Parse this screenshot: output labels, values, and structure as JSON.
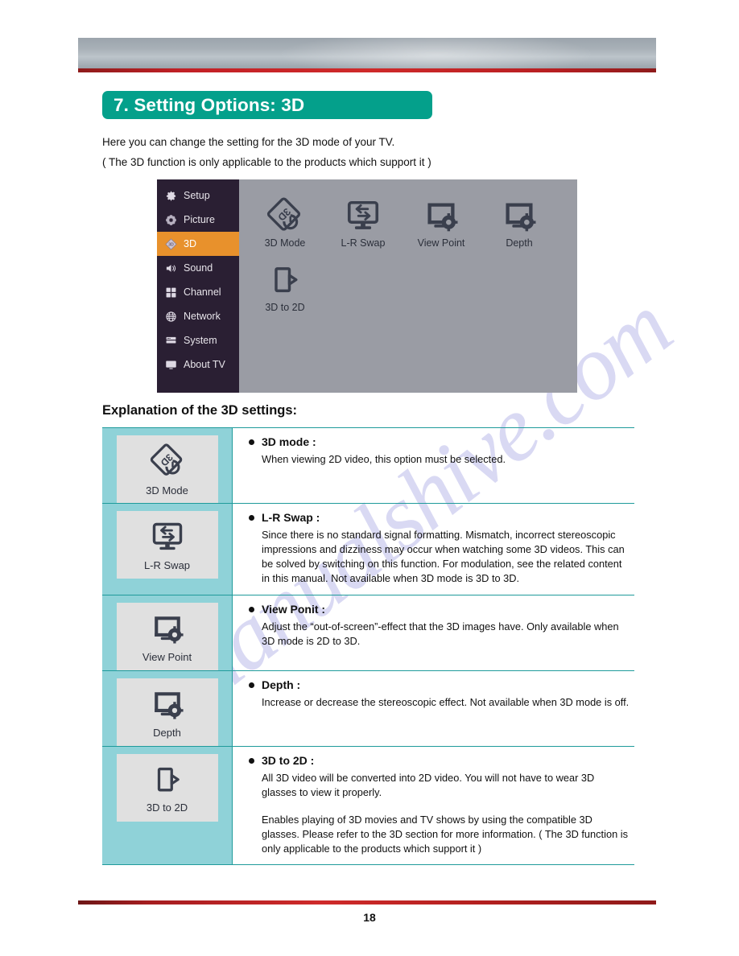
{
  "document": {
    "page_number": "18",
    "watermark": "manualshive.com"
  },
  "section": {
    "title": "7. Setting Options: 3D",
    "accent_color": "#04a08b"
  },
  "intro": {
    "line1": "Here you can change the setting for the 3D mode of your TV.",
    "line2": "( The 3D function is only applicable to the products which support it )"
  },
  "osd": {
    "highlight_color": "#e8912c",
    "sidebar": [
      {
        "label": "Setup",
        "icon": "gear-icon",
        "active": false
      },
      {
        "label": "Picture",
        "icon": "flower-icon",
        "active": false
      },
      {
        "label": "3D",
        "icon": "diamond-3d-icon",
        "active": true
      },
      {
        "label": "Sound",
        "icon": "speaker-icon",
        "active": false
      },
      {
        "label": "Channel",
        "icon": "grid-icon",
        "active": false
      },
      {
        "label": "Network",
        "icon": "globe-icon",
        "active": false
      },
      {
        "label": "System",
        "icon": "server-icon",
        "active": false
      },
      {
        "label": "About TV",
        "icon": "monitor-icon",
        "active": false
      }
    ],
    "tiles": [
      {
        "label": "3D Mode",
        "icon": "3d-mode-icon"
      },
      {
        "label": "L-R Swap",
        "icon": "lr-swap-icon"
      },
      {
        "label": "View Point",
        "icon": "view-point-icon"
      },
      {
        "label": "Depth",
        "icon": "depth-icon"
      },
      {
        "label": "3D to 2D",
        "icon": "3d-to-2d-icon"
      }
    ]
  },
  "explanation": {
    "heading": "Explanation of the 3D settings:",
    "rows": [
      {
        "icon_label": "3D Mode",
        "icon": "3d-mode-icon",
        "title": "3D mode :",
        "paragraphs": [
          "When viewing 2D video, this option must be selected."
        ]
      },
      {
        "icon_label": "L-R Swap",
        "icon": "lr-swap-icon",
        "title": "L-R Swap :",
        "paragraphs": [
          "Since there is no standard signal formatting. Mismatch, incorrect stereoscopic impressions and dizziness may occur when watching some 3D videos. This can be solved by switching on this function. For modulation, see the related content in this manual. Not available when 3D mode is 3D to 3D."
        ]
      },
      {
        "icon_label": "View Point",
        "icon": "view-point-icon",
        "title": "View Ponit :",
        "paragraphs": [
          "Adjust the “out-of-screen”-effect that the 3D images have. Only available when 3D mode is 2D to 3D."
        ]
      },
      {
        "icon_label": "Depth",
        "icon": "depth-icon",
        "title": "Depth :",
        "paragraphs": [
          "Increase or decrease the stereoscopic effect. Not available when 3D mode is off."
        ]
      },
      {
        "icon_label": "3D to 2D",
        "icon": "3d-to-2d-icon",
        "title": "3D to 2D :",
        "paragraphs": [
          "All 3D video will be converted into 2D video. You will not have to wear 3D glasses to view it properly.",
          "Enables playing of 3D movies and TV shows by using the compatible 3D glasses. Please refer to the 3D section for more information. ( The 3D function is only applicable to the products which support it )"
        ]
      }
    ]
  }
}
